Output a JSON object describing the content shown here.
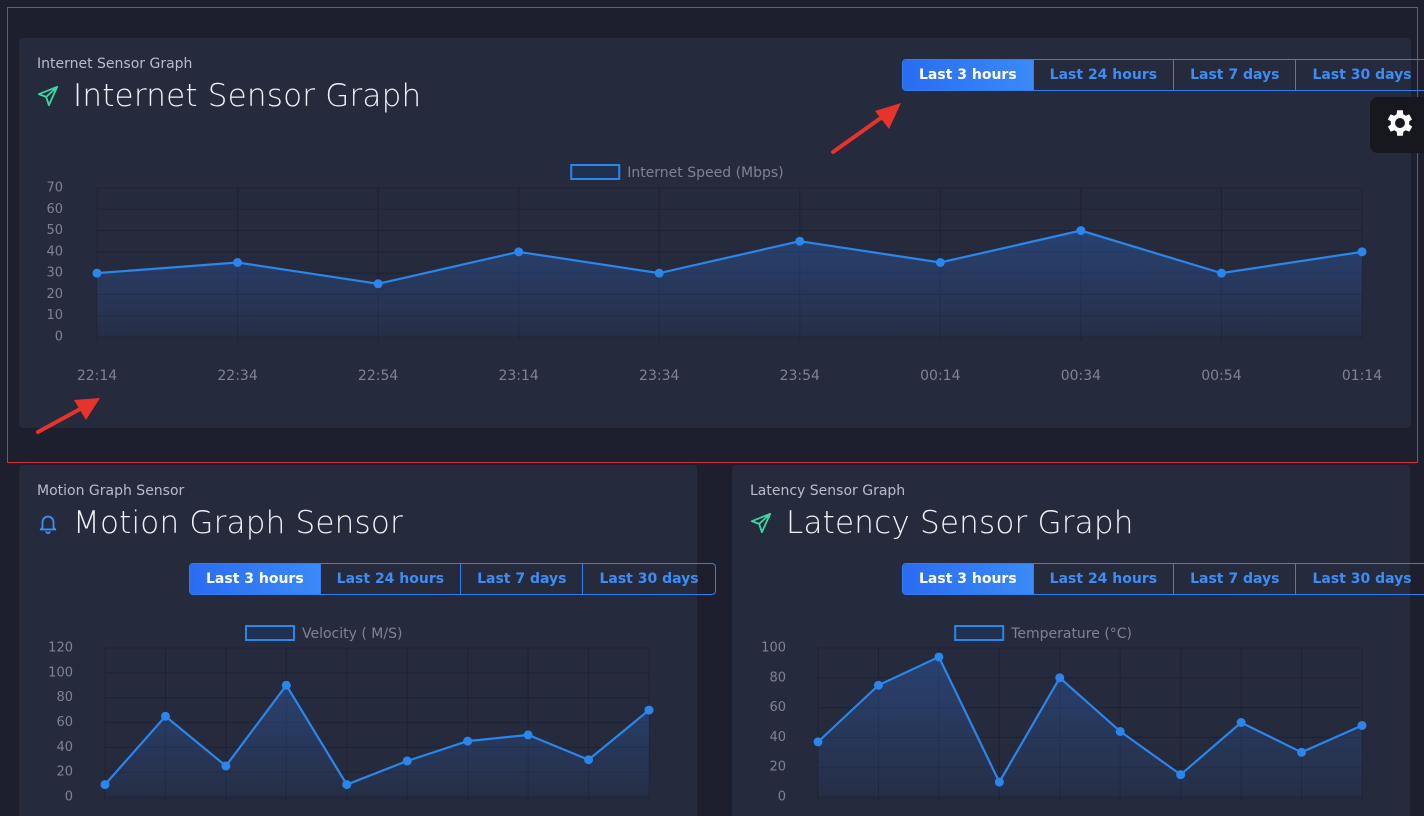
{
  "colors": {
    "accent": "#2f7ff0",
    "line": "#2a86ea",
    "green_icon": "#3ad7a0",
    "blue_icon": "#3d8df5",
    "annotation": "#e8322c"
  },
  "range_buttons": [
    "Last 3 hours",
    "Last 24 hours",
    "Last 7 days",
    "Last 30 days"
  ],
  "internet_card": {
    "subtitle": "Internet Sensor Graph",
    "title": "Internet Sensor Graph",
    "icon": "paper-plane-icon",
    "active_range": "Last 3 hours"
  },
  "motion_card": {
    "subtitle": "Motion Graph Sensor",
    "title": "Motion Graph Sensor",
    "icon": "bell-icon",
    "active_range": "Last 3 hours"
  },
  "latency_card": {
    "subtitle": "Latency Sensor Graph",
    "title": "Latency Sensor Graph",
    "icon": "paper-plane-icon",
    "active_range": "Last 3 hours"
  },
  "settings": {
    "icon": "gear-icon"
  },
  "chart_data": [
    {
      "type": "line",
      "legend": "Internet Speed (Mbps)",
      "categories": [
        "22:14",
        "22:34",
        "22:54",
        "23:14",
        "23:34",
        "23:54",
        "00:14",
        "00:34",
        "00:54",
        "01:14"
      ],
      "series": [
        {
          "name": "Internet Speed (Mbps)",
          "values": [
            30,
            35,
            25,
            40,
            30,
            45,
            35,
            50,
            30,
            40
          ]
        }
      ],
      "y_ticks": [
        0,
        10,
        20,
        30,
        40,
        50,
        60,
        70
      ],
      "ylim": [
        0,
        70
      ],
      "grid": true,
      "fill": true
    },
    {
      "type": "line",
      "legend": "Velocity ( M/S)",
      "series": [
        {
          "name": "Velocity ( M/S)",
          "values": [
            10,
            65,
            25,
            90,
            10,
            29,
            45,
            50,
            30,
            70
          ]
        }
      ],
      "y_ticks": [
        0,
        20,
        40,
        60,
        80,
        100,
        120
      ],
      "ylim": [
        0,
        120
      ],
      "grid": true,
      "fill": true
    },
    {
      "type": "line",
      "legend": "Temperature (°C)",
      "series": [
        {
          "name": "Temperature (°C)",
          "values": [
            37,
            75,
            94,
            10,
            80,
            44,
            15,
            50,
            30,
            48
          ]
        }
      ],
      "y_ticks": [
        0,
        20,
        40,
        60,
        80,
        100
      ],
      "ylim": [
        0,
        100
      ],
      "grid": true,
      "fill": true
    }
  ]
}
